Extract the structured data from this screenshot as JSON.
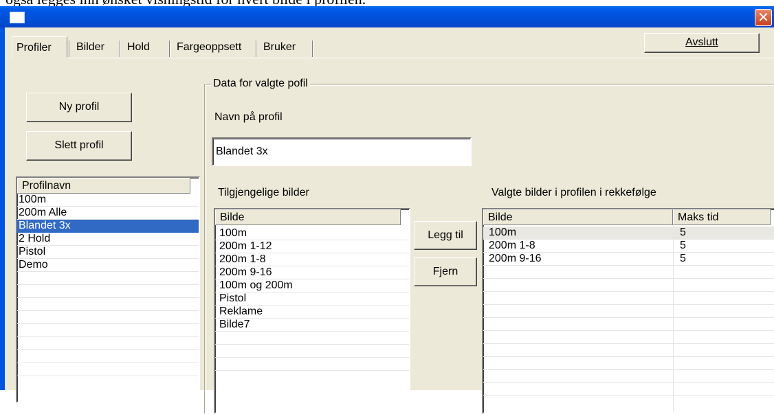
{
  "document": {
    "caption_fragment": "også legges inn ønsket visningstid for hvert bilde i profilen."
  },
  "window": {
    "title": "",
    "close_glyph": "✕"
  },
  "tabs": [
    {
      "label": "Profiler",
      "active": true
    },
    {
      "label": "Bilder",
      "active": false
    },
    {
      "label": "Hold",
      "active": false
    },
    {
      "label": "Fargeoppsett",
      "active": false
    },
    {
      "label": "Bruker",
      "active": false
    }
  ],
  "exit_button": {
    "label": "Avslutt"
  },
  "profile_actions": {
    "new_label": "Ny profil",
    "delete_label": "Slett profil"
  },
  "profile_list": {
    "header": "Profilnavn",
    "items": [
      "100m",
      "200m Alle",
      "Blandet 3x",
      "2 Hold",
      "Pistol",
      "Demo"
    ],
    "selected_index": 2
  },
  "details": {
    "group_title": "Data for valgte pofil",
    "name_label": "Navn på profil",
    "name_value": "Blandet 3x"
  },
  "available": {
    "title": "Tilgjengelige bilder",
    "header": "Bilde",
    "items": [
      "100m",
      "200m 1-12",
      "200m 1-8",
      "200m 9-16",
      "100m og 200m",
      "Pistol",
      "Reklame",
      "Bilde7"
    ]
  },
  "transfer": {
    "add_label": "Legg til",
    "remove_label": "Fjern"
  },
  "selected": {
    "title": "Valgte bilder i profilen i rekkefølge",
    "headers": [
      "Bilde",
      "Maks tid"
    ],
    "rows": [
      {
        "image": "100m",
        "max_time": "5"
      },
      {
        "image": "200m 1-8",
        "max_time": "5"
      },
      {
        "image": "200m 9-16",
        "max_time": "5"
      }
    ]
  },
  "colors": {
    "titlebar": "#0054e3",
    "face": "#ece9d8",
    "selection": "#316ac5",
    "close": "#c53f1f"
  }
}
